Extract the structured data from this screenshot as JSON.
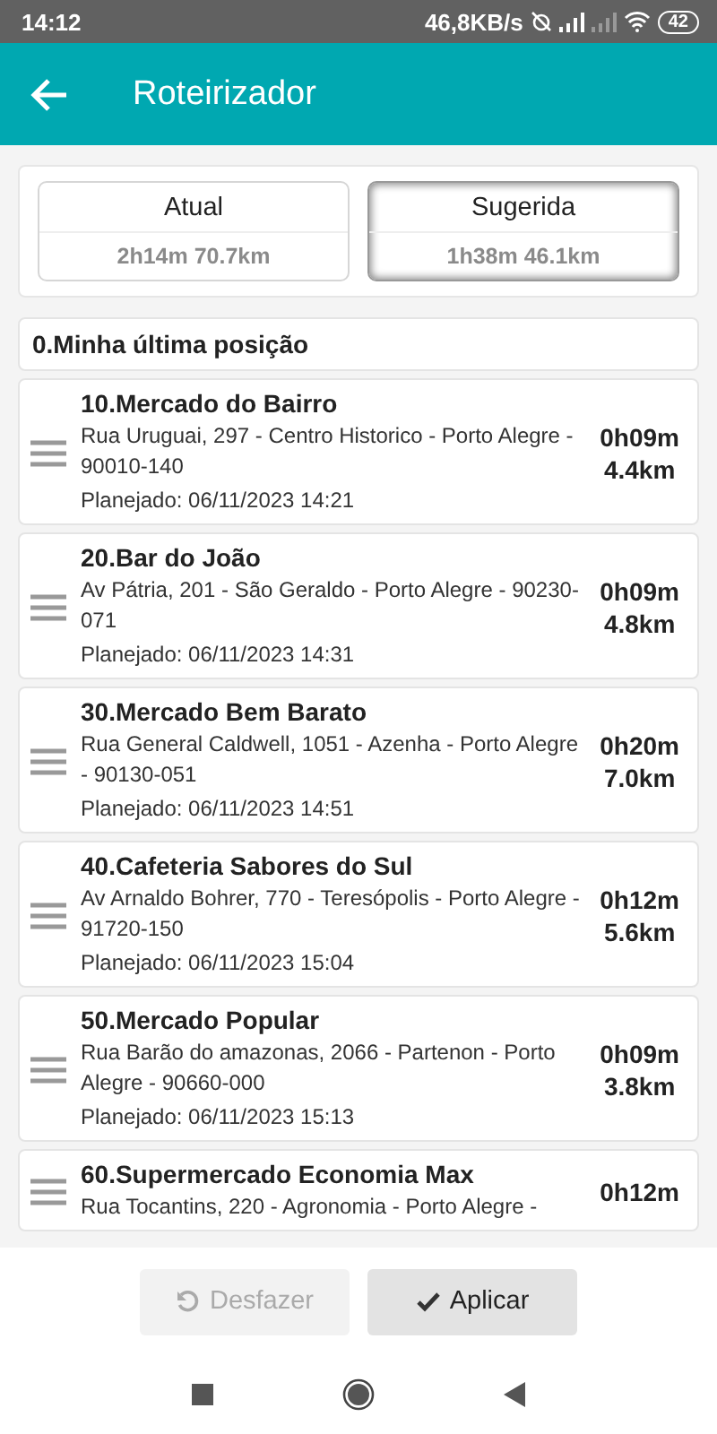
{
  "status_bar": {
    "time": "14:12",
    "speed": "46,8KB/s",
    "battery": "42"
  },
  "app_bar": {
    "title": "Roteirizador"
  },
  "route_options": [
    {
      "label": "Atual",
      "summary": "2h14m 70.7km",
      "selected": false
    },
    {
      "label": "Sugerida",
      "summary": "1h38m 46.1km",
      "selected": true
    }
  ],
  "start": {
    "label": "0.Minha última posição"
  },
  "stops": [
    {
      "name": "10.Mercado do Bairro",
      "address": "Rua Uruguai, 297 - Centro Historico - Porto Alegre - 90010-140",
      "planned": "Planejado: 06/11/2023 14:21",
      "duration": "0h09m",
      "distance": "4.4km"
    },
    {
      "name": "20.Bar do João",
      "address": "Av Pátria, 201 - São Geraldo - Porto Alegre - 90230-071",
      "planned": "Planejado: 06/11/2023 14:31",
      "duration": "0h09m",
      "distance": "4.8km"
    },
    {
      "name": "30.Mercado Bem Barato",
      "address": "Rua General Caldwell, 1051 - Azenha - Porto Alegre - 90130-051",
      "planned": "Planejado: 06/11/2023 14:51",
      "duration": "0h20m",
      "distance": "7.0km"
    },
    {
      "name": "40.Cafeteria Sabores do Sul",
      "address": "Av Arnaldo Bohrer, 770 - Teresópolis - Porto Alegre - 91720-150",
      "planned": "Planejado: 06/11/2023 15:04",
      "duration": "0h12m",
      "distance": "5.6km"
    },
    {
      "name": "50.Mercado Popular",
      "address": "Rua Barão do amazonas, 2066 - Partenon - Porto Alegre - 90660-000",
      "planned": "Planejado: 06/11/2023 15:13",
      "duration": "0h09m",
      "distance": "3.8km"
    },
    {
      "name": "60.Supermercado Economia Max",
      "address": "Rua Tocantins, 220 - Agronomia - Porto Alegre -",
      "duration": "0h12m"
    }
  ],
  "actions": [
    {
      "label": "Desfazer",
      "kind": "undo",
      "disabled": true
    },
    {
      "label": "Aplicar",
      "kind": "apply",
      "disabled": false
    }
  ]
}
